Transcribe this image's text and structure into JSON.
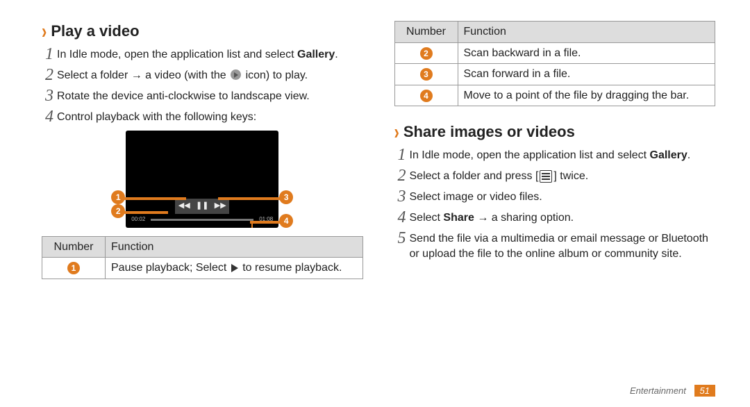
{
  "sections": {
    "play": {
      "title": "Play a video",
      "steps": [
        {
          "pre": "In Idle mode, open the application list and select ",
          "bold": "Gallery",
          "post": "."
        },
        {
          "pre": "Select a folder → a video (with the ",
          "icon": "play-circle",
          "post": " icon) to play."
        },
        {
          "text": "Rotate the device anti-clockwise to landscape view."
        },
        {
          "text": "Control playback with the following keys:"
        }
      ]
    },
    "share": {
      "title": "Share images or videos",
      "steps": [
        {
          "pre": "In Idle mode, open the application list and select ",
          "bold": "Gallery",
          "post": "."
        },
        {
          "pre": "Select a folder and press [",
          "icon": "menu",
          "post": "] twice."
        },
        {
          "text": "Select image or video files."
        },
        {
          "pre": "Select ",
          "bold": "Share",
          "post": " → a sharing option."
        },
        {
          "text": "Send the file via a multimedia or email message or Bluetooth or upload the file to the online album or community site."
        }
      ]
    }
  },
  "player": {
    "time_left": "00:02",
    "time_right": "01:08"
  },
  "callouts": {
    "c1": "1",
    "c2": "2",
    "c3": "3",
    "c4": "4"
  },
  "tables": {
    "headers": {
      "num": "Number",
      "func": "Function"
    },
    "left_rows": [
      {
        "n": "1",
        "f_pre": "Pause playback; Select ",
        "f_icon": "play",
        "f_post": " to resume playback."
      }
    ],
    "right_rows": [
      {
        "n": "2",
        "f": "Scan backward in a file."
      },
      {
        "n": "3",
        "f": "Scan forward in a file."
      },
      {
        "n": "4",
        "f": "Move to a point of the file by dragging the bar."
      }
    ]
  },
  "footer": {
    "section": "Entertainment",
    "page": "51"
  }
}
